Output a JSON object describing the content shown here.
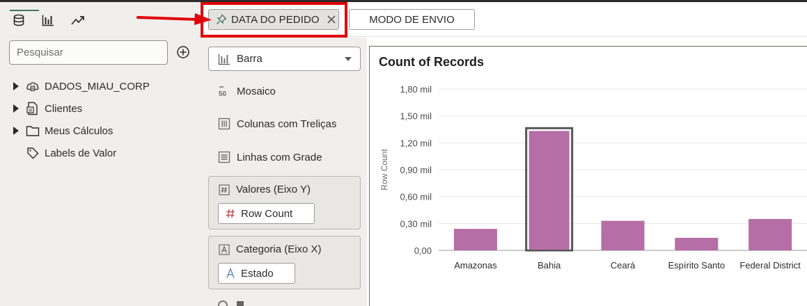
{
  "left_panel": {
    "tabs": [
      {
        "icon": "database-icon"
      },
      {
        "icon": "bar-chart-icon"
      },
      {
        "icon": "trend-icon"
      }
    ],
    "search": {
      "placeholder": "Pesquisar"
    },
    "tree": [
      {
        "label": "DADOS_MIAU_CORP",
        "icon": "cloud-dataset-icon",
        "expandable": true
      },
      {
        "label": "Clientes",
        "icon": "dataset-file-icon",
        "expandable": true
      },
      {
        "label": "Meus Cálculos",
        "icon": "folder-icon",
        "expandable": true
      },
      {
        "label": "Labels de Valor",
        "icon": "tag-icon",
        "expandable": false
      }
    ]
  },
  "filter_bar": {
    "filters": [
      {
        "label": "DATA DO PEDIDO",
        "pinned": true
      },
      {
        "label": "MODO DE ENVIO",
        "pinned": false
      }
    ],
    "highlight_color": "#e1000a"
  },
  "grammar": {
    "viz_type": "Barra",
    "viz_options": [
      "Mosaico",
      "Colunas com Treliças",
      "Linhas com Grade"
    ],
    "sections": [
      {
        "title": "Valores (Eixo Y)",
        "item": "Row Count",
        "item_icon": "hash-icon"
      },
      {
        "title": "Categoria (Eixo X)",
        "item": "Estado",
        "item_icon": "attribute-a-icon"
      }
    ]
  },
  "chart_data": {
    "type": "bar",
    "title": "Count of Records",
    "ylabel": "Row Count",
    "xlabel": "",
    "categories": [
      "Amazonas",
      "Bahia",
      "Ceará",
      "Espírito Santo",
      "Federal District"
    ],
    "values": [
      240,
      1340,
      330,
      140,
      350
    ],
    "ylim": [
      0,
      1800
    ],
    "yticks": [
      {
        "value": 0,
        "label": "0,00"
      },
      {
        "value": 300,
        "label": "0,30 mil"
      },
      {
        "value": 600,
        "label": "0,60 mil"
      },
      {
        "value": 900,
        "label": "0,90 mil"
      },
      {
        "value": 1200,
        "label": "1,20 mil"
      },
      {
        "value": 1500,
        "label": "1,50 mil"
      },
      {
        "value": 1800,
        "label": "1,80 mil"
      }
    ],
    "bar_color": "#b56ea6",
    "selected_category": "Bahia",
    "grid": true
  }
}
